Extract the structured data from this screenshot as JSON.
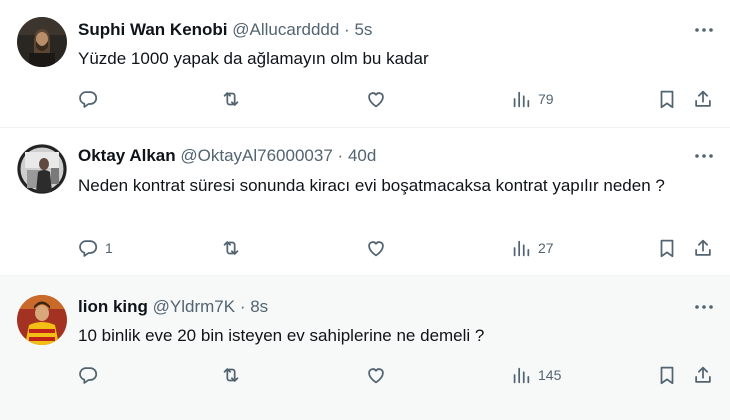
{
  "tweets": [
    {
      "name": "Suphi Wan Kenobi",
      "handle": "@Allucardddd",
      "separator": "·",
      "time": "5s",
      "text": "Yüzde 1000 yapak da ağlamayın olm bu kadar",
      "replies": "",
      "views": "79"
    },
    {
      "name": "Oktay Alkan",
      "handle": "@OktayAl76000037",
      "separator": "·",
      "time": "40d",
      "text": "Neden kontrat süresi sonunda kiracı evi boşatmacaksa kontrat yapılır neden ?",
      "replies": "1",
      "views": "27"
    },
    {
      "name": "lion king",
      "handle": "@Yldrm7K",
      "separator": "·",
      "time": "8s",
      "text": "10 binlik eve 20 bin isteyen ev sahiplerine ne demeli ?",
      "replies": "",
      "views": "145"
    }
  ],
  "icons": {
    "reply": "reply-icon",
    "retweet": "retweet-icon",
    "like": "like-icon",
    "views": "views-icon",
    "bookmark": "bookmark-icon",
    "share": "share-icon",
    "more": "more-icon"
  },
  "colors": {
    "text": "#0f1419",
    "secondary": "#536471",
    "divider": "#eff3f4",
    "highlight_bg": "#f7f9f9"
  }
}
